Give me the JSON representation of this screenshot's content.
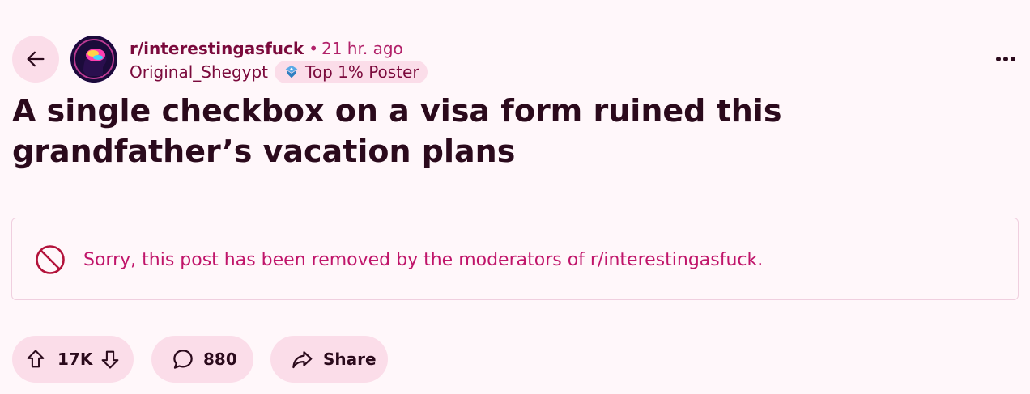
{
  "post": {
    "subreddit": "r/interestingasfuck",
    "separator": "•",
    "time_ago": "21 hr. ago",
    "author": "Original_Shegypt",
    "flair": "Top 1% Poster",
    "title": "A single checkbox on a visa form ruined this grandfather’s vacation plans",
    "removed_notice": "Sorry, this post has been removed by the moderators of r/interestingasfuck."
  },
  "actions": {
    "vote_count": "17K",
    "comment_count": "880",
    "share_label": "Share"
  },
  "icons": {
    "back": "arrow-left-icon",
    "overflow": "more-horizontal-icon",
    "flair": "top-poster-badge-icon",
    "removed": "ban-icon",
    "upvote": "arrow-up-icon",
    "downvote": "arrow-down-icon",
    "comment": "speech-bubble-icon",
    "share": "share-arrow-icon"
  },
  "colors": {
    "background": "#fff7fa",
    "pill": "#fbdde9",
    "accent": "#c0156a",
    "text": "#2b0a1c",
    "removed_icon": "#b3123a"
  }
}
